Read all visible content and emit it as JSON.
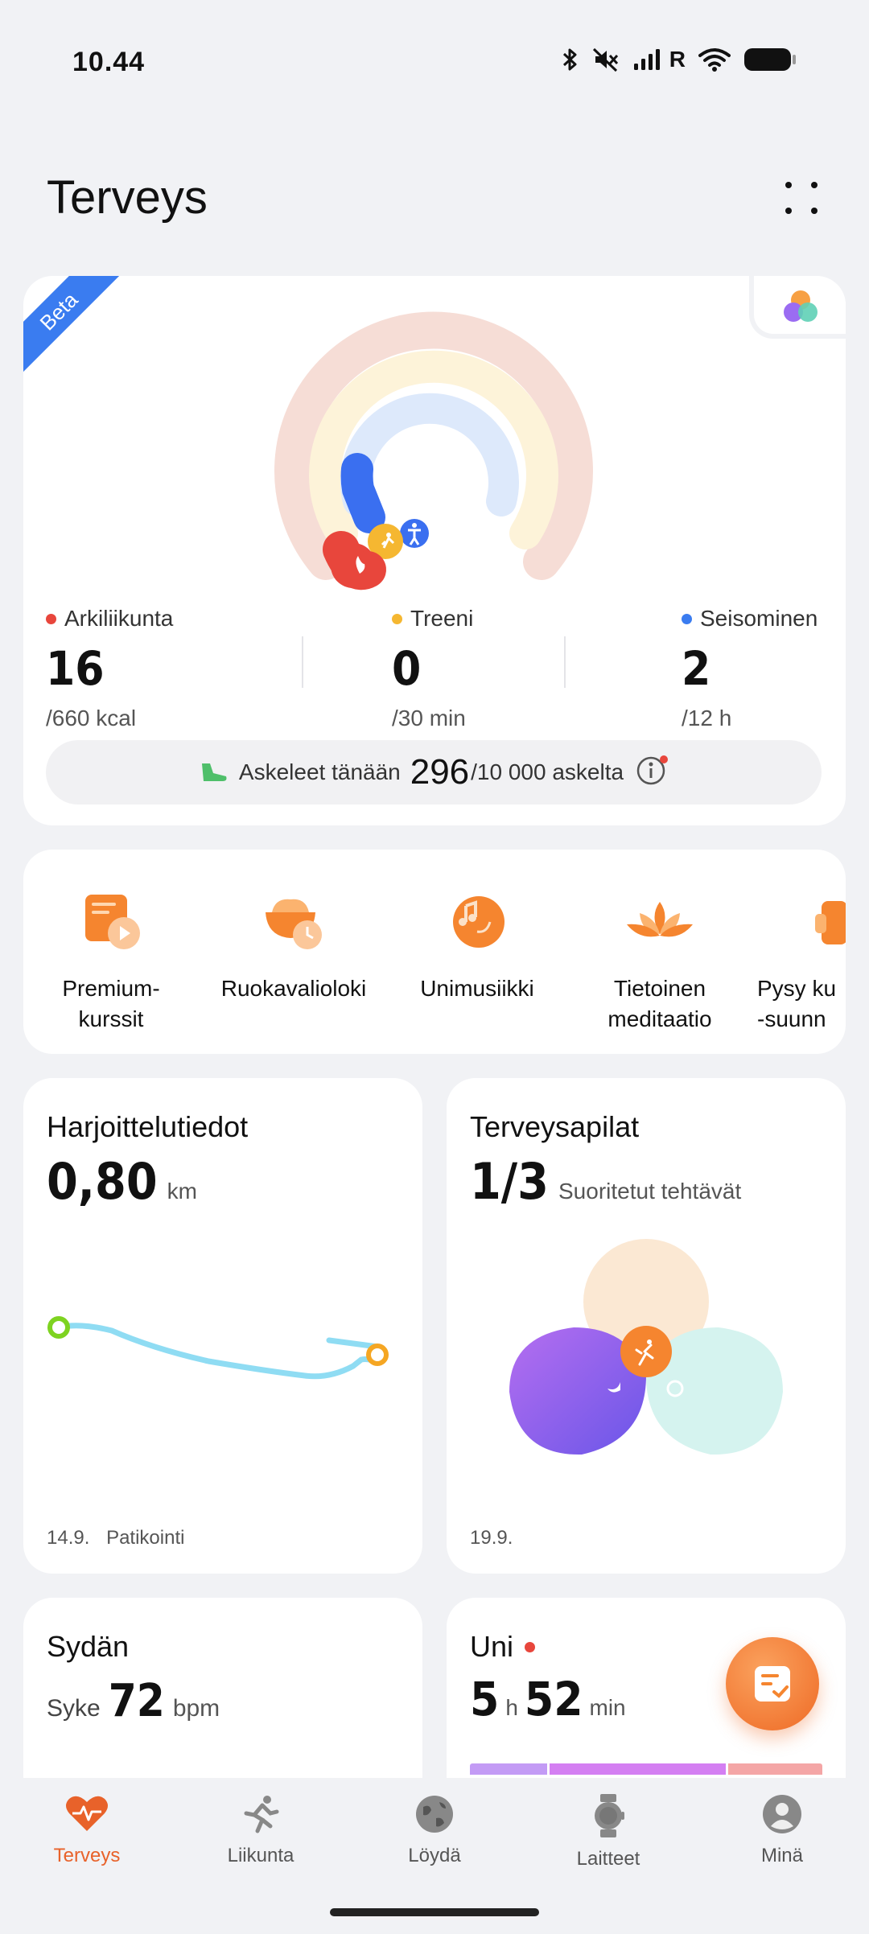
{
  "status_bar": {
    "time": "10.44",
    "signal_letter": "R"
  },
  "page": {
    "title": "Terveys"
  },
  "activity": {
    "beta_label": "Beta",
    "metrics": [
      {
        "label": "Arkiliikunta",
        "value": "16",
        "goal": "/660 kcal",
        "color": "#e8463c"
      },
      {
        "label": "Treeni",
        "value": "0",
        "goal": "/30 min",
        "color": "#f5b731"
      },
      {
        "label": "Seisominen",
        "value": "2",
        "goal": "/12 h",
        "color": "#3a7cf0"
      }
    ],
    "ring_progress": {
      "arkiliikunta": 0.024,
      "treeni": 0.0,
      "seisominen": 0.167
    },
    "steps": {
      "label": "Askeleet tänään",
      "count": "296",
      "goal": "/10 000 askelta"
    }
  },
  "shortcuts": [
    {
      "label": "Premium-\nkurssit",
      "icon": "premium-courses-icon"
    },
    {
      "label": "Ruokavalioloki",
      "icon": "diet-log-icon"
    },
    {
      "label": "Unimusiikki",
      "icon": "sleep-music-icon"
    },
    {
      "label": "Tietoinen\nmeditaatio",
      "icon": "meditation-lotus-icon"
    },
    {
      "label": "Pysy ku\n-suunn",
      "icon": "posture-icon"
    }
  ],
  "exercise_card": {
    "title": "Harjoittelutiedot",
    "value": "0,80",
    "unit": "km",
    "date": "14.9.",
    "type": "Patikointi"
  },
  "health_clover_card": {
    "title": "Terveysapilat",
    "value": "1/3",
    "unit": "Suoritetut tehtävät",
    "date": "19.9."
  },
  "heart_card": {
    "title": "Sydän",
    "label": "Syke",
    "value": "72",
    "unit": "bpm"
  },
  "sleep_card": {
    "title": "Uni",
    "hours": "5",
    "hours_unit": "h",
    "minutes": "52",
    "minutes_unit": "min"
  },
  "bottom_nav": [
    {
      "label": "Terveys",
      "icon": "heart-pulse-icon",
      "active": true
    },
    {
      "label": "Liikunta",
      "icon": "running-icon",
      "active": false
    },
    {
      "label": "Löydä",
      "icon": "globe-icon",
      "active": false
    },
    {
      "label": "Laitteet",
      "icon": "watch-icon",
      "active": false
    },
    {
      "label": "Minä",
      "icon": "profile-icon",
      "active": false
    }
  ],
  "colors": {
    "accent": "#e8622a",
    "background": "#f1f2f5"
  }
}
